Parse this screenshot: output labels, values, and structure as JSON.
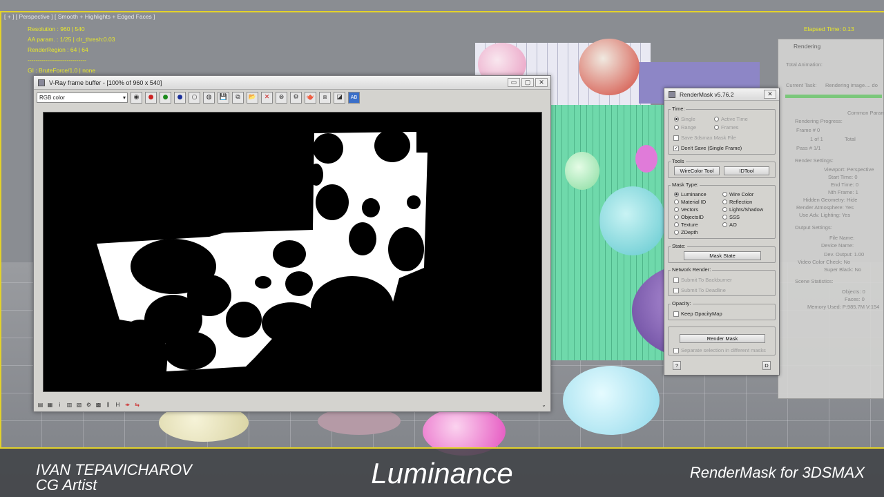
{
  "viewport": {
    "label": "[ + ] [ Perspective ] [ Smooth + Highlights + Edged Faces ]",
    "overlay": [
      "Resolution : 960 | 540",
      "AA param. : 1/25 | clr_thresh:0.03",
      "RenderRegion : 64 | 64",
      "------------------------------",
      "GI : BruteForce/1.0 | none"
    ],
    "elapsed": "Elapsed Time: 0.13"
  },
  "vfb": {
    "title": "V-Ray frame buffer - [100% of 960 x 540]",
    "channel": "RGB color",
    "win_buttons": [
      "▭",
      "▢",
      "✕"
    ],
    "toolbar_icons": [
      "◉",
      "●",
      "●",
      "●",
      "○",
      "◍",
      "💾",
      "⧉",
      "📂",
      "✕",
      "⊗",
      "⚙",
      "🫖",
      "⧈",
      "◪",
      "AB"
    ],
    "status_icons": [
      "▤",
      "▦",
      "i",
      "▥",
      "▧",
      "⚙",
      "▩",
      "⫼",
      "H",
      "⇹",
      "⇆",
      "⌄"
    ]
  },
  "rendermask": {
    "title": "RenderMask v5.76.2",
    "close": "✕",
    "time": {
      "label": "Time:",
      "single": "Single",
      "active_time": "Active Time",
      "range": "Range",
      "frames": "Frames",
      "save_mask": "Save 3dsmax Mask File",
      "dont_save": "Don't Save (Single Frame)"
    },
    "tools": {
      "label": "Tools",
      "wirecolor": "WireColor Tool",
      "idtool": "IDTool"
    },
    "mask_type": {
      "label": "Mask Type:",
      "options": [
        "Luminance",
        "Material ID",
        "Vectors",
        "ObjectsID",
        "Texture",
        "ZDepth"
      ],
      "options_right": [
        "Wire Color",
        "Reflection",
        "Lights/Shadow",
        "SSS",
        "AO"
      ]
    },
    "state": {
      "label": "State:",
      "button": "Mask State"
    },
    "network": {
      "label": "Network Render:",
      "backburner": "Submit To Backburner",
      "deadline": "Submit To Deadline"
    },
    "opacity": {
      "label": "Opacity:",
      "keep": "Keep OpacityMap"
    },
    "render_button": "Render Mask",
    "separate": "Separate selection in different masks",
    "help": "?",
    "d": "D"
  },
  "rendering_window": {
    "title": "Rendering",
    "total_animation": "Total Animation:",
    "current_task": "Current Task:",
    "current_task_value": "Rendering image.... do",
    "common_params": "Common Param",
    "progress": [
      "Rendering Progress:",
      "Frame #  0",
      "1 of 1",
      "Total",
      "Pass #  1/1"
    ],
    "settings": [
      "Render Settings:",
      "Viewport: Perspective",
      "Start Time: 0",
      "End Time: 0",
      "Nth Frame: 1",
      "Hidden Geometry: Hide",
      "Render Atmosphere: Yes",
      "Use Adv. Lighting: Yes"
    ],
    "output": [
      "Output Settings:",
      "File Name:",
      "Device Name:",
      "Dev. Output: 1.00",
      "Video Color Check: No",
      "Super Black: No"
    ],
    "scene": [
      "Scene Statistics:",
      "Objects: 0",
      "Faces: 0",
      "Memory Used: P:985.7M V:154"
    ]
  },
  "banner": {
    "author_name": "IVAN TEPAVICHAROV",
    "author_role": "CG Artist",
    "center_title": "Luminance",
    "product": "RenderMask for 3DSMAX"
  }
}
